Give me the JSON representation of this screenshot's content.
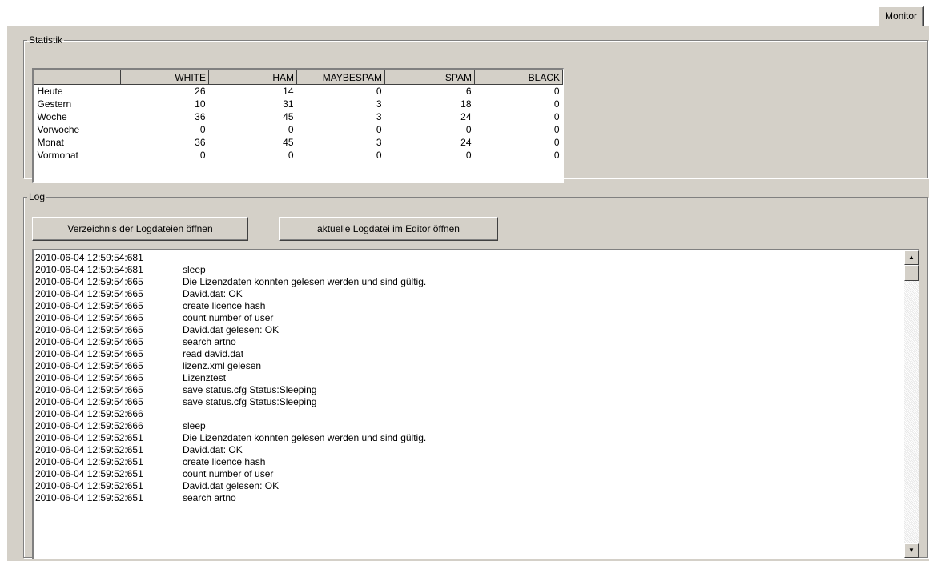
{
  "tabs": {
    "monitor": "Monitor"
  },
  "statistik": {
    "legend": "Statistik",
    "columns": [
      "",
      "WHITE",
      "HAM",
      "MAYBESPAM",
      "SPAM",
      "BLACK"
    ],
    "rows": [
      {
        "label": "Heute",
        "white": "26",
        "ham": "14",
        "maybespam": "0",
        "spam": "6",
        "black": "0"
      },
      {
        "label": "Gestern",
        "white": "10",
        "ham": "31",
        "maybespam": "3",
        "spam": "18",
        "black": "0"
      },
      {
        "label": "Woche",
        "white": "36",
        "ham": "45",
        "maybespam": "3",
        "spam": "24",
        "black": "0"
      },
      {
        "label": "Vorwoche",
        "white": "0",
        "ham": "0",
        "maybespam": "0",
        "spam": "0",
        "black": "0"
      },
      {
        "label": "Monat",
        "white": "36",
        "ham": "45",
        "maybespam": "3",
        "spam": "24",
        "black": "0"
      },
      {
        "label": "Vormonat",
        "white": "0",
        "ham": "0",
        "maybespam": "0",
        "spam": "0",
        "black": "0"
      }
    ]
  },
  "log": {
    "legend": "Log",
    "open_dir_label": "Verzeichnis der Logdateien öffnen",
    "open_editor_label": "aktuelle Logdatei im Editor öffnen",
    "entries": [
      {
        "ts": "2010-06-04 12:59:54:681",
        "msg": ""
      },
      {
        "ts": "2010-06-04 12:59:54:681",
        "msg": "sleep"
      },
      {
        "ts": "2010-06-04 12:59:54:665",
        "msg": "Die Lizenzdaten konnten gelesen werden und sind gültig."
      },
      {
        "ts": "2010-06-04 12:59:54:665",
        "msg": "David.dat: OK"
      },
      {
        "ts": "2010-06-04 12:59:54:665",
        "msg": "create licence hash"
      },
      {
        "ts": "2010-06-04 12:59:54:665",
        "msg": "count number of user"
      },
      {
        "ts": "2010-06-04 12:59:54:665",
        "msg": "David.dat gelesen: OK"
      },
      {
        "ts": "2010-06-04 12:59:54:665",
        "msg": "search artno"
      },
      {
        "ts": "2010-06-04 12:59:54:665",
        "msg": "read david.dat"
      },
      {
        "ts": "2010-06-04 12:59:54:665",
        "msg": "lizenz.xml gelesen"
      },
      {
        "ts": "2010-06-04 12:59:54:665",
        "msg": "Lizenztest"
      },
      {
        "ts": "2010-06-04 12:59:54:665",
        "msg": "save status.cfg Status:Sleeping"
      },
      {
        "ts": "2010-06-04 12:59:54:665",
        "msg": "save status.cfg Status:Sleeping"
      },
      {
        "ts": "2010-06-04 12:59:52:666",
        "msg": ""
      },
      {
        "ts": "2010-06-04 12:59:52:666",
        "msg": "sleep"
      },
      {
        "ts": "2010-06-04 12:59:52:651",
        "msg": "Die Lizenzdaten konnten gelesen werden und sind gültig."
      },
      {
        "ts": "2010-06-04 12:59:52:651",
        "msg": "David.dat: OK"
      },
      {
        "ts": "2010-06-04 12:59:52:651",
        "msg": "create licence hash"
      },
      {
        "ts": "2010-06-04 12:59:52:651",
        "msg": "count number of user"
      },
      {
        "ts": "2010-06-04 12:59:52:651",
        "msg": "David.dat gelesen: OK"
      },
      {
        "ts": "2010-06-04 12:59:52:651",
        "msg": "search artno"
      }
    ]
  },
  "icons": {
    "scroll_up": "scroll-up-arrow-icon",
    "scroll_down": "scroll-down-arrow-icon"
  }
}
